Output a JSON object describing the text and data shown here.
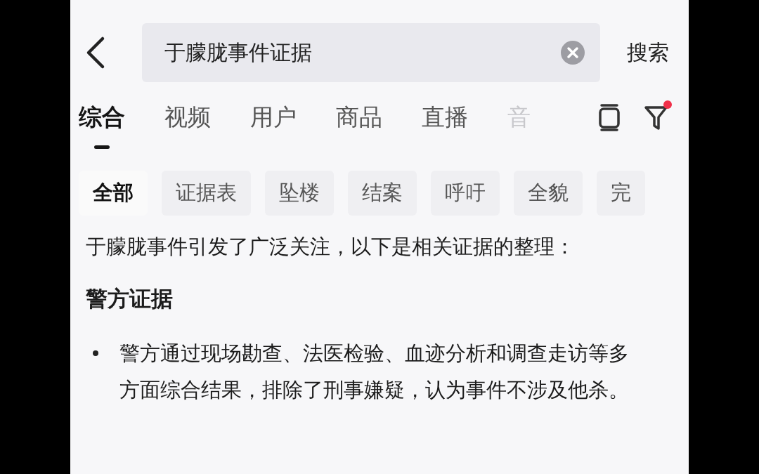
{
  "search": {
    "query": "于朦胧事件证据",
    "action": "搜索"
  },
  "tabs": [
    {
      "label": "综合",
      "selected": true
    },
    {
      "label": "视频",
      "selected": false
    },
    {
      "label": "用户",
      "selected": false
    },
    {
      "label": "商品",
      "selected": false
    },
    {
      "label": "直播",
      "selected": false
    },
    {
      "label": "音",
      "selected": false
    }
  ],
  "filter": {
    "has_notice": true
  },
  "chips": [
    {
      "label": "全部",
      "selected": true
    },
    {
      "label": "证据表",
      "selected": false
    },
    {
      "label": "坠楼",
      "selected": false
    },
    {
      "label": "结案",
      "selected": false
    },
    {
      "label": "呼吁",
      "selected": false
    },
    {
      "label": "全貌",
      "selected": false
    },
    {
      "label": "完",
      "selected": false
    }
  ],
  "answer": {
    "intro": "于朦胧事件引发了广泛关注，以下是相关证据的整理：",
    "heading": "警方证据",
    "bullets": [
      "警方通过现场勘查、法医检验、血迹分析和调查走访等多方面综合结果，排除了刑事嫌疑，认为事件不涉及他杀。"
    ]
  }
}
